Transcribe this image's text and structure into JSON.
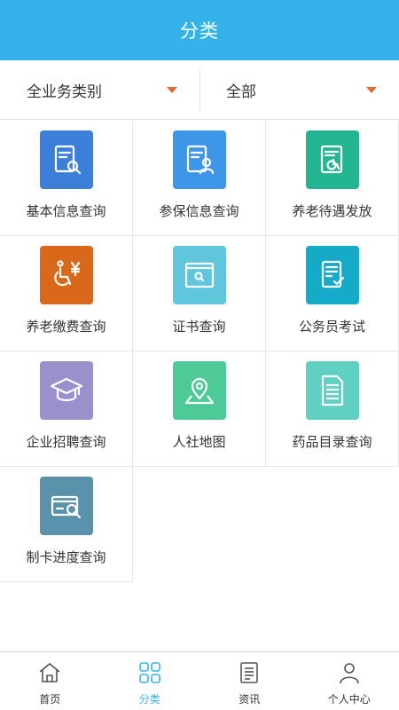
{
  "header": {
    "title": "分类"
  },
  "filters": [
    {
      "label": "全业务类别"
    },
    {
      "label": "全部"
    }
  ],
  "services": [
    {
      "label": "基本信息查询",
      "icon": "document-search-icon",
      "color": "#3b7fd9"
    },
    {
      "label": "参保信息查询",
      "icon": "document-person-icon",
      "color": "#3e96e8"
    },
    {
      "label": "养老待遇发放",
      "icon": "document-wheelchair-icon",
      "color": "#23b491"
    },
    {
      "label": "养老缴费查询",
      "icon": "wheelchair-yen-icon",
      "color": "#d9681a"
    },
    {
      "label": "证书查询",
      "icon": "browser-search-icon",
      "color": "#5fc6dc"
    },
    {
      "label": "公务员考试",
      "icon": "checklist-icon",
      "color": "#15aac8"
    },
    {
      "label": "企业招聘查询",
      "icon": "graduation-cap-icon",
      "color": "#9b8fcc"
    },
    {
      "label": "人社地图",
      "icon": "map-pin-icon",
      "color": "#4dca98"
    },
    {
      "label": "药品目录查询",
      "icon": "document-list-icon",
      "color": "#5fd0c2"
    },
    {
      "label": "制卡进度查询",
      "icon": "card-search-icon",
      "color": "#5a91ab"
    }
  ],
  "tabbar": [
    {
      "label": "首页",
      "icon": "home-icon",
      "active": false
    },
    {
      "label": "分类",
      "icon": "grid-icon",
      "active": true
    },
    {
      "label": "资讯",
      "icon": "news-icon",
      "active": false
    },
    {
      "label": "个人中心",
      "icon": "person-icon",
      "active": false
    }
  ],
  "colors": {
    "header": "#33b3ea",
    "active_tab": "#33b3ea",
    "caret": "#e06a2b"
  }
}
